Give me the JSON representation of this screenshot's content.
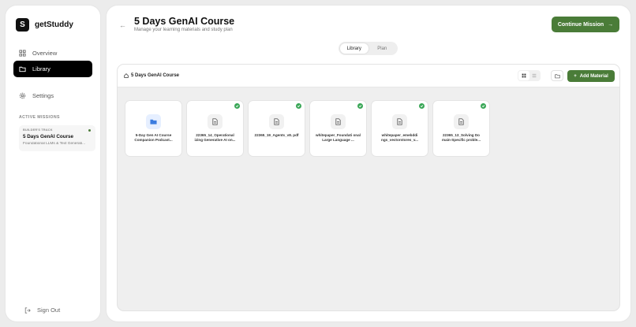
{
  "brand": {
    "mark": "S",
    "name": "getStuddy"
  },
  "nav": [
    {
      "label": "Overview",
      "icon": "grid-icon",
      "active": false
    },
    {
      "label": "Library",
      "icon": "folder-icon",
      "active": true
    },
    {
      "label": "Settings",
      "icon": "gear-icon",
      "active": false
    }
  ],
  "missions": {
    "section_label": "ACTIVE MISSIONS",
    "card": {
      "track": "BUILDER'S TRACK",
      "title": "5 Days GenAI Course",
      "subtitle": "Foundational LLMs & Text Generati..."
    }
  },
  "signout_label": "Sign Out",
  "header": {
    "title": "5 Days GenAI Course",
    "subtitle": "Manage your learning materials and study plan",
    "continue_label": "Continue Mission"
  },
  "tabs": [
    {
      "label": "Library",
      "active": true
    },
    {
      "label": "Plan",
      "active": false
    }
  ],
  "panel": {
    "breadcrumb": "5 Days GenAI Course",
    "add_label": "Add Material"
  },
  "materials": [
    {
      "name": "5-Day Gen AI Course Companion Podcast...",
      "type": "folder",
      "done": false
    },
    {
      "name": "22365_14_Operational izing Generative AI on...",
      "type": "file",
      "done": true
    },
    {
      "name": "22365_19_Agents_v8. pdf",
      "type": "file",
      "done": true
    },
    {
      "name": "whitepaper_Foundati onal Large Language ...",
      "type": "file",
      "done": true
    },
    {
      "name": "whitepaper_emebddi ngs_vectorstores_v...",
      "type": "file",
      "done": true
    },
    {
      "name": "22365_13_Solving Do main-Specific proble...",
      "type": "file",
      "done": true
    }
  ],
  "colors": {
    "accent": "#4a7c38",
    "check": "#3aa757",
    "folder": "#3b7ce0"
  }
}
